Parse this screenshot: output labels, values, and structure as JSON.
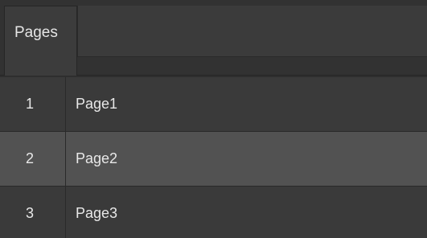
{
  "tabs": [
    {
      "label": "Pages",
      "active": true
    }
  ],
  "pages": [
    {
      "number": "1",
      "name": "Page1",
      "selected": false
    },
    {
      "number": "2",
      "name": "Page2",
      "selected": true
    },
    {
      "number": "3",
      "name": "Page3",
      "selected": false
    }
  ],
  "colors": {
    "background": "#2e2e2e",
    "row": "#3a3a3a",
    "row_selected": "#525252",
    "text": "#e8e8e8"
  }
}
